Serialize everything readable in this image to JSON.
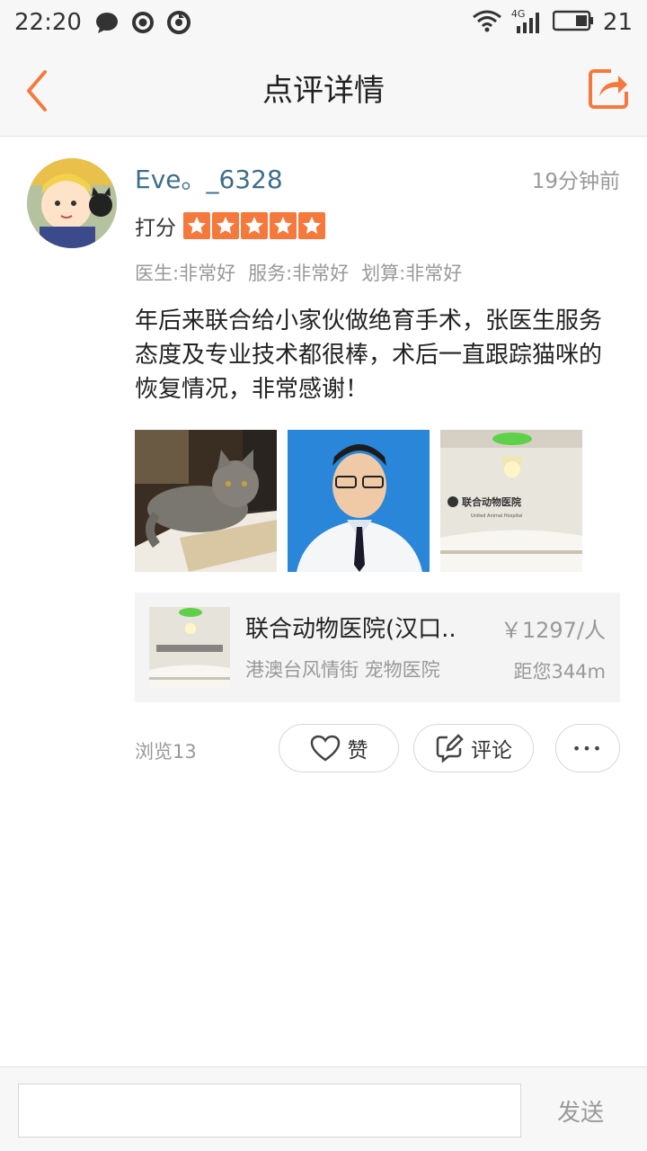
{
  "status_bar": {
    "time": "22:20",
    "network": "4G",
    "battery": "21",
    "icons": [
      "chat-bubble-icon",
      "target-icon",
      "sync-icon",
      "wifi-icon",
      "signal-icon",
      "battery-icon"
    ]
  },
  "header": {
    "title": "点评详情",
    "back_icon": "chevron-left-icon",
    "share_icon": "share-icon"
  },
  "review": {
    "username": "Eve。_6328",
    "time_ago": "19分钟前",
    "score_label": "打分",
    "rating_stars": 5,
    "sub_scores": [
      "医生:非常好",
      "服务:非常好",
      "划算:非常好"
    ],
    "text": "年后来联合给小家伙做绝育手术，张医生服务态度及专业技术都很棒，术后一直跟踪猫咪的恢复情况，非常感谢！",
    "photos": [
      "cat-photo",
      "doctor-photo",
      "hospital-lobby-photo"
    ],
    "hospital_sign": "联合动物医院",
    "hospital_sign_en": "United Animal Hospital"
  },
  "shop": {
    "name": "联合动物医院(汉口..",
    "price": "￥1297/人",
    "tag": "港澳台风情街 宠物医院",
    "distance": "距您344m"
  },
  "actions": {
    "views": "浏览13",
    "like_label": "赞",
    "comment_label": "评论",
    "more_label": "•••"
  },
  "bottom": {
    "input_placeholder": "",
    "send_label": "发送"
  },
  "colors": {
    "accent": "#f5793c",
    "username": "#3f6e8c",
    "muted": "#999999"
  }
}
